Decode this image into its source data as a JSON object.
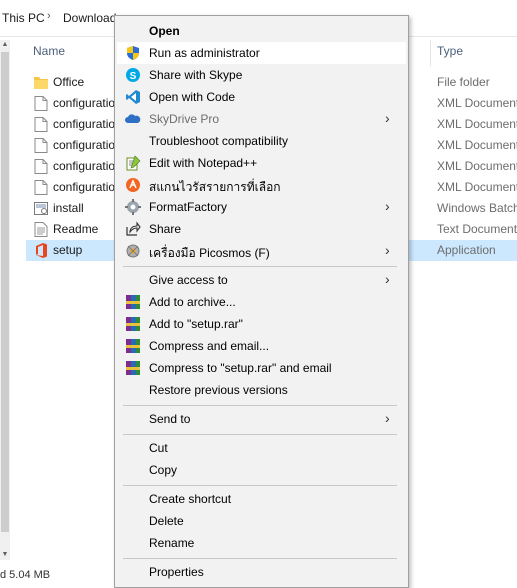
{
  "breadcrumb": {
    "items": [
      "This PC",
      "Download"
    ],
    "separator": "›"
  },
  "columns": {
    "name": "Name",
    "type": "Type"
  },
  "files": [
    {
      "name": "Office",
      "type": "File folder",
      "icon": "folder-icon"
    },
    {
      "name": "configuratio",
      "type": "XML Document",
      "icon": "document-icon"
    },
    {
      "name": "configuratio",
      "type": "XML Document",
      "icon": "document-icon"
    },
    {
      "name": "configuratio",
      "type": "XML Document",
      "icon": "document-icon"
    },
    {
      "name": "configuratio",
      "type": "XML Document",
      "icon": "document-icon"
    },
    {
      "name": "configuratio",
      "type": "XML Document",
      "icon": "document-icon"
    },
    {
      "name": "install",
      "type": "Windows Batch",
      "icon": "batch-file-icon"
    },
    {
      "name": "Readme",
      "type": "Text Document",
      "icon": "text-file-icon"
    },
    {
      "name": "setup",
      "type": "Application",
      "icon": "office-icon"
    }
  ],
  "status": {
    "selected_size": "d  5.04 MB"
  },
  "menu": {
    "items": [
      {
        "label": "Open",
        "icon": ""
      },
      {
        "label": "Run as administrator",
        "icon": "uac-shield-icon"
      },
      {
        "label": "Share with Skype",
        "icon": "skype-icon"
      },
      {
        "label": "Open with Code",
        "icon": "vscode-icon"
      },
      {
        "label": "SkyDrive Pro",
        "icon": "skydrive-icon",
        "submenu": true
      },
      {
        "label": "Troubleshoot compatibility",
        "icon": ""
      },
      {
        "label": "Edit with Notepad++",
        "icon": "notepad-plus-plus-icon"
      },
      {
        "label": "สแกนไวรัสรายการที่เลือก",
        "icon": "antivirus-icon"
      },
      {
        "label": "FormatFactory",
        "icon": "format-factory-icon",
        "submenu": true
      },
      {
        "label": "Share",
        "icon": "share-icon"
      },
      {
        "label": "เครื่องมือ Picosmos (F)",
        "icon": "picosmos-icon",
        "submenu": true
      },
      {
        "label": "Give access to",
        "icon": "",
        "submenu": true
      },
      {
        "label": "Add to archive...",
        "icon": "winrar-icon"
      },
      {
        "label": "Add to \"setup.rar\"",
        "icon": "winrar-icon"
      },
      {
        "label": "Compress and email...",
        "icon": "winrar-icon"
      },
      {
        "label": "Compress to \"setup.rar\" and email",
        "icon": "winrar-icon"
      },
      {
        "label": "Restore previous versions",
        "icon": ""
      },
      {
        "label": "Send to",
        "icon": "",
        "submenu": true
      },
      {
        "label": "Cut",
        "icon": ""
      },
      {
        "label": "Copy",
        "icon": ""
      },
      {
        "label": "Create shortcut",
        "icon": ""
      },
      {
        "label": "Delete",
        "icon": ""
      },
      {
        "label": "Rename",
        "icon": ""
      },
      {
        "label": "Properties",
        "icon": ""
      }
    ],
    "submenu_arrow": "›"
  },
  "colors": {
    "selection": "#cce8ff",
    "menu_background": "#f2f2f2",
    "menu_hover": "#ffffff",
    "header_text": "#4c607a",
    "type_text": "#6d6d6d"
  }
}
